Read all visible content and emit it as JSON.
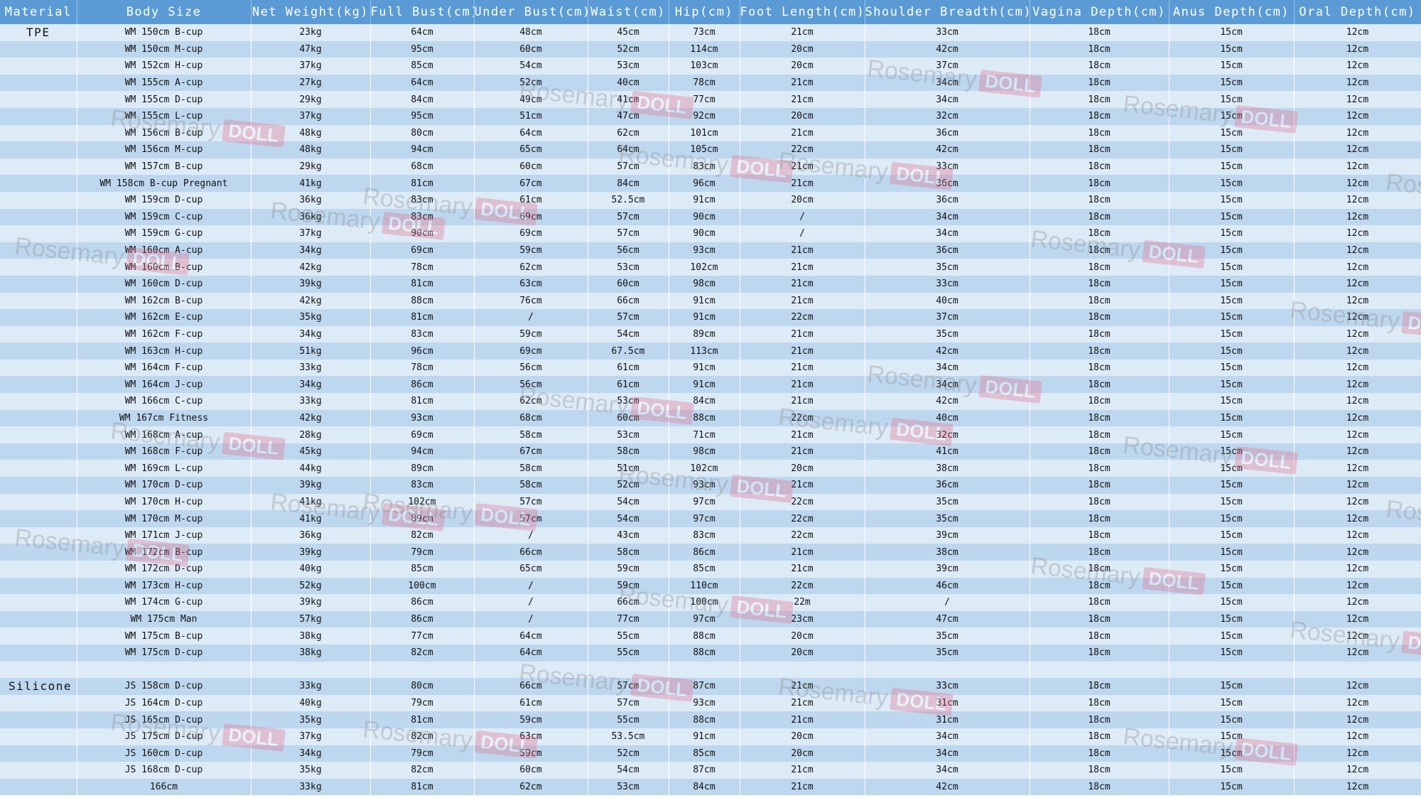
{
  "headers": [
    "Material",
    "Body Size",
    "Net Weight(kg)",
    "Full Bust(cm)",
    "Under Bust(cm)",
    "Waist(cm)",
    "Hip(cm)",
    "Foot Length(cm)",
    "Shoulder Breadth(cm)",
    "Vagina Depth(cm)",
    "Anus Depth(cm)",
    "Oral Depth(cm)"
  ],
  "watermark": {
    "text": "Rosemary",
    "badge": "DOLL"
  },
  "colors": {
    "header_bg": "#5b9bd5",
    "row_light": "#ddebf7",
    "row_dark": "#bdd7ee",
    "watermark_badge": "#e56b88"
  },
  "rows": [
    {
      "material": "TPE",
      "size": "WM 150cm B-cup",
      "weight": "23kg",
      "full_bust": "64cm",
      "under_bust": "48cm",
      "waist": "45cm",
      "hip": "73cm",
      "foot": "21cm",
      "shoulder": "33cm",
      "vagina": "18cm",
      "anus": "15cm",
      "oral": "12cm"
    },
    {
      "material": "",
      "size": "WM 150cm M-cup",
      "weight": "47kg",
      "full_bust": "95cm",
      "under_bust": "60cm",
      "waist": "52cm",
      "hip": "114cm",
      "foot": "20cm",
      "shoulder": "42cm",
      "vagina": "18cm",
      "anus": "15cm",
      "oral": "12cm"
    },
    {
      "material": "",
      "size": "WM 152cm H-cup",
      "weight": "37kg",
      "full_bust": "85cm",
      "under_bust": "54cm",
      "waist": "53cm",
      "hip": "103cm",
      "foot": "20cm",
      "shoulder": "37cm",
      "vagina": "18cm",
      "anus": "15cm",
      "oral": "12cm"
    },
    {
      "material": "",
      "size": "WM 155cm A-cup",
      "weight": "27kg",
      "full_bust": "64cm",
      "under_bust": "52cm",
      "waist": "40cm",
      "hip": "78cm",
      "foot": "21cm",
      "shoulder": "34cm",
      "vagina": "18cm",
      "anus": "15cm",
      "oral": "12cm"
    },
    {
      "material": "",
      "size": "WM 155cm D-cup",
      "weight": "29kg",
      "full_bust": "84cm",
      "under_bust": "49cm",
      "waist": "41cm",
      "hip": "77cm",
      "foot": "21cm",
      "shoulder": "34cm",
      "vagina": "18cm",
      "anus": "15cm",
      "oral": "12cm"
    },
    {
      "material": "",
      "size": "WM 155cm L-cup",
      "weight": "37kg",
      "full_bust": "95cm",
      "under_bust": "51cm",
      "waist": "47cm",
      "hip": "92cm",
      "foot": "20cm",
      "shoulder": "32cm",
      "vagina": "18cm",
      "anus": "15cm",
      "oral": "12cm"
    },
    {
      "material": "",
      "size": "WM 156cm B-cup",
      "weight": "48kg",
      "full_bust": "80cm",
      "under_bust": "64cm",
      "waist": "62cm",
      "hip": "101cm",
      "foot": "21cm",
      "shoulder": "36cm",
      "vagina": "18cm",
      "anus": "15cm",
      "oral": "12cm"
    },
    {
      "material": "",
      "size": "WM 156cm M-cup",
      "weight": "48kg",
      "full_bust": "94cm",
      "under_bust": "65cm",
      "waist": "64cm",
      "hip": "105cm",
      "foot": "22cm",
      "shoulder": "42cm",
      "vagina": "18cm",
      "anus": "15cm",
      "oral": "12cm"
    },
    {
      "material": "",
      "size": "WM 157cm B-cup",
      "weight": "29kg",
      "full_bust": "68cm",
      "under_bust": "60cm",
      "waist": "57cm",
      "hip": "83cm",
      "foot": "21cm",
      "shoulder": "33cm",
      "vagina": "18cm",
      "anus": "15cm",
      "oral": "12cm"
    },
    {
      "material": "",
      "size": "WM 158cm B-cup Pregnant",
      "weight": "41kg",
      "full_bust": "81cm",
      "under_bust": "67cm",
      "waist": "84cm",
      "hip": "96cm",
      "foot": "21cm",
      "shoulder": "36cm",
      "vagina": "18cm",
      "anus": "15cm",
      "oral": "12cm"
    },
    {
      "material": "",
      "size": "WM 159cm D-cup",
      "weight": "36kg",
      "full_bust": "83cm",
      "under_bust": "61cm",
      "waist": "52.5cm",
      "hip": "91cm",
      "foot": "20cm",
      "shoulder": "36cm",
      "vagina": "18cm",
      "anus": "15cm",
      "oral": "12cm"
    },
    {
      "material": "",
      "size": "WM 159cm C-cup",
      "weight": "36kg",
      "full_bust": "83cm",
      "under_bust": "69cm",
      "waist": "57cm",
      "hip": "90cm",
      "foot": "/",
      "shoulder": "34cm",
      "vagina": "18cm",
      "anus": "15cm",
      "oral": "12cm"
    },
    {
      "material": "",
      "size": "WM 159cm G-cup",
      "weight": "37kg",
      "full_bust": "90cm",
      "under_bust": "69cm",
      "waist": "57cm",
      "hip": "90cm",
      "foot": "/",
      "shoulder": "34cm",
      "vagina": "18cm",
      "anus": "15cm",
      "oral": "12cm"
    },
    {
      "material": "",
      "size": "WM 160cm A-cup",
      "weight": "34kg",
      "full_bust": "69cm",
      "under_bust": "59cm",
      "waist": "56cm",
      "hip": "93cm",
      "foot": "21cm",
      "shoulder": "36cm",
      "vagina": "18cm",
      "anus": "15cm",
      "oral": "12cm"
    },
    {
      "material": "",
      "size": "WM 160cm B-cup",
      "weight": "42kg",
      "full_bust": "78cm",
      "under_bust": "62cm",
      "waist": "53cm",
      "hip": "102cm",
      "foot": "21cm",
      "shoulder": "35cm",
      "vagina": "18cm",
      "anus": "15cm",
      "oral": "12cm"
    },
    {
      "material": "",
      "size": "WM 160cm D-cup",
      "weight": "39kg",
      "full_bust": "81cm",
      "under_bust": "63cm",
      "waist": "60cm",
      "hip": "98cm",
      "foot": "21cm",
      "shoulder": "33cm",
      "vagina": "18cm",
      "anus": "15cm",
      "oral": "12cm"
    },
    {
      "material": "",
      "size": "WM 162cm B-cup",
      "weight": "42kg",
      "full_bust": "88cm",
      "under_bust": "76cm",
      "waist": "66cm",
      "hip": "91cm",
      "foot": "21cm",
      "shoulder": "40cm",
      "vagina": "18cm",
      "anus": "15cm",
      "oral": "12cm"
    },
    {
      "material": "",
      "size": "WM 162cm E-cup",
      "weight": "35kg",
      "full_bust": "81cm",
      "under_bust": "/",
      "waist": "57cm",
      "hip": "91cm",
      "foot": "22cm",
      "shoulder": "37cm",
      "vagina": "18cm",
      "anus": "15cm",
      "oral": "12cm"
    },
    {
      "material": "",
      "size": "WM 162cm F-cup",
      "weight": "34kg",
      "full_bust": "83cm",
      "under_bust": "59cm",
      "waist": "54cm",
      "hip": "89cm",
      "foot": "21cm",
      "shoulder": "35cm",
      "vagina": "18cm",
      "anus": "15cm",
      "oral": "12cm"
    },
    {
      "material": "",
      "size": "WM 163cm H-cup",
      "weight": "51kg",
      "full_bust": "96cm",
      "under_bust": "69cm",
      "waist": "67.5cm",
      "hip": "113cm",
      "foot": "21cm",
      "shoulder": "42cm",
      "vagina": "18cm",
      "anus": "15cm",
      "oral": "12cm"
    },
    {
      "material": "",
      "size": "WM 164cm F-cup",
      "weight": "33kg",
      "full_bust": "78cm",
      "under_bust": "56cm",
      "waist": "61cm",
      "hip": "91cm",
      "foot": "21cm",
      "shoulder": "34cm",
      "vagina": "18cm",
      "anus": "15cm",
      "oral": "12cm"
    },
    {
      "material": "",
      "size": "WM 164cm J-cup",
      "weight": "34kg",
      "full_bust": "86cm",
      "under_bust": "56cm",
      "waist": "61cm",
      "hip": "91cm",
      "foot": "21cm",
      "shoulder": "34cm",
      "vagina": "18cm",
      "anus": "15cm",
      "oral": "12cm"
    },
    {
      "material": "",
      "size": "WM 166cm C-cup",
      "weight": "33kg",
      "full_bust": "81cm",
      "under_bust": "62cm",
      "waist": "53cm",
      "hip": "84cm",
      "foot": "21cm",
      "shoulder": "42cm",
      "vagina": "18cm",
      "anus": "15cm",
      "oral": "12cm"
    },
    {
      "material": "",
      "size": "WM 167cm Fitness",
      "weight": "42kg",
      "full_bust": "93cm",
      "under_bust": "68cm",
      "waist": "60cm",
      "hip": "88cm",
      "foot": "22cm",
      "shoulder": "40cm",
      "vagina": "18cm",
      "anus": "15cm",
      "oral": "12cm"
    },
    {
      "material": "",
      "size": "WM 168cm A-cup",
      "weight": "28kg",
      "full_bust": "69cm",
      "under_bust": "58cm",
      "waist": "53cm",
      "hip": "71cm",
      "foot": "21cm",
      "shoulder": "32cm",
      "vagina": "18cm",
      "anus": "15cm",
      "oral": "12cm"
    },
    {
      "material": "",
      "size": "WM 168cm F-cup",
      "weight": "45kg",
      "full_bust": "94cm",
      "under_bust": "67cm",
      "waist": "58cm",
      "hip": "98cm",
      "foot": "21cm",
      "shoulder": "41cm",
      "vagina": "18cm",
      "anus": "15cm",
      "oral": "12cm"
    },
    {
      "material": "",
      "size": "WM 169cm L-cup",
      "weight": "44kg",
      "full_bust": "89cm",
      "under_bust": "58cm",
      "waist": "51cm",
      "hip": "102cm",
      "foot": "20cm",
      "shoulder": "38cm",
      "vagina": "18cm",
      "anus": "15cm",
      "oral": "12cm"
    },
    {
      "material": "",
      "size": "WM 170cm D-cup",
      "weight": "39kg",
      "full_bust": "83cm",
      "under_bust": "58cm",
      "waist": "52cm",
      "hip": "93cm",
      "foot": "21cm",
      "shoulder": "36cm",
      "vagina": "18cm",
      "anus": "15cm",
      "oral": "12cm"
    },
    {
      "material": "",
      "size": "WM 170cm H-cup",
      "weight": "41kg",
      "full_bust": "102cm",
      "under_bust": "57cm",
      "waist": "54cm",
      "hip": "97cm",
      "foot": "22cm",
      "shoulder": "35cm",
      "vagina": "18cm",
      "anus": "15cm",
      "oral": "12cm"
    },
    {
      "material": "",
      "size": "WM 170cm M-cup",
      "weight": "41kg",
      "full_bust": "89cm",
      "under_bust": "57cm",
      "waist": "54cm",
      "hip": "97cm",
      "foot": "22cm",
      "shoulder": "35cm",
      "vagina": "18cm",
      "anus": "15cm",
      "oral": "12cm"
    },
    {
      "material": "",
      "size": "WM 171cm J-cup",
      "weight": "36kg",
      "full_bust": "82cm",
      "under_bust": "/",
      "waist": "43cm",
      "hip": "83cm",
      "foot": "22cm",
      "shoulder": "39cm",
      "vagina": "18cm",
      "anus": "15cm",
      "oral": "12cm"
    },
    {
      "material": "",
      "size": "WM 172cm B-cup",
      "weight": "39kg",
      "full_bust": "79cm",
      "under_bust": "66cm",
      "waist": "58cm",
      "hip": "86cm",
      "foot": "21cm",
      "shoulder": "38cm",
      "vagina": "18cm",
      "anus": "15cm",
      "oral": "12cm"
    },
    {
      "material": "",
      "size": "WM 172cm D-cup",
      "weight": "40kg",
      "full_bust": "85cm",
      "under_bust": "65cm",
      "waist": "59cm",
      "hip": "85cm",
      "foot": "21cm",
      "shoulder": "39cm",
      "vagina": "18cm",
      "anus": "15cm",
      "oral": "12cm"
    },
    {
      "material": "",
      "size": "WM 173cm H-cup",
      "weight": "52kg",
      "full_bust": "100cm",
      "under_bust": "/",
      "waist": "59cm",
      "hip": "110cm",
      "foot": "22cm",
      "shoulder": "46cm",
      "vagina": "18cm",
      "anus": "15cm",
      "oral": "12cm"
    },
    {
      "material": "",
      "size": "WM 174cm G-cup",
      "weight": "39kg",
      "full_bust": "86cm",
      "under_bust": "/",
      "waist": "66cm",
      "hip": "100cm",
      "foot": "22m",
      "shoulder": "/",
      "vagina": "18cm",
      "anus": "15cm",
      "oral": "12cm"
    },
    {
      "material": "",
      "size": "WM 175cm Man",
      "weight": "57kg",
      "full_bust": "86cm",
      "under_bust": "/",
      "waist": "77cm",
      "hip": "97cm",
      "foot": "23cm",
      "shoulder": "47cm",
      "vagina": "18cm",
      "anus": "15cm",
      "oral": "12cm"
    },
    {
      "material": "",
      "size": "WM 175cm B-cup",
      "weight": "38kg",
      "full_bust": "77cm",
      "under_bust": "64cm",
      "waist": "55cm",
      "hip": "88cm",
      "foot": "20cm",
      "shoulder": "35cm",
      "vagina": "18cm",
      "anus": "15cm",
      "oral": "12cm"
    },
    {
      "material": "",
      "size": "WM 175cm D-cup",
      "weight": "38kg",
      "full_bust": "82cm",
      "under_bust": "64cm",
      "waist": "55cm",
      "hip": "88cm",
      "foot": "20cm",
      "shoulder": "35cm",
      "vagina": "18cm",
      "anus": "15cm",
      "oral": "12cm"
    },
    {
      "material": "",
      "size": "",
      "weight": "",
      "full_bust": "",
      "under_bust": "",
      "waist": "",
      "hip": "",
      "foot": "",
      "shoulder": "",
      "vagina": "",
      "anus": "",
      "oral": ""
    },
    {
      "material": "Silicone",
      "size": "JS 158cm D-cup",
      "weight": "33kg",
      "full_bust": "80cm",
      "under_bust": "66cm",
      "waist": "57cm",
      "hip": "87cm",
      "foot": "21cm",
      "shoulder": "33cm",
      "vagina": "18cm",
      "anus": "15cm",
      "oral": "12cm"
    },
    {
      "material": "",
      "size": "JS 164cm D-cup",
      "weight": "40kg",
      "full_bust": "79cm",
      "under_bust": "61cm",
      "waist": "57cm",
      "hip": "93cm",
      "foot": "21cm",
      "shoulder": "31cm",
      "vagina": "18cm",
      "anus": "15cm",
      "oral": "12cm"
    },
    {
      "material": "",
      "size": "JS 165cm D-cup",
      "weight": "35kg",
      "full_bust": "81cm",
      "under_bust": "59cm",
      "waist": "55cm",
      "hip": "88cm",
      "foot": "21cm",
      "shoulder": "31cm",
      "vagina": "18cm",
      "anus": "15cm",
      "oral": "12cm"
    },
    {
      "material": "",
      "size": "JS 175cm D-cup",
      "weight": "37kg",
      "full_bust": "82cm",
      "under_bust": "63cm",
      "waist": "53.5cm",
      "hip": "91cm",
      "foot": "20cm",
      "shoulder": "34cm",
      "vagina": "18cm",
      "anus": "15cm",
      "oral": "12cm"
    },
    {
      "material": "",
      "size": "JS 160cm D-cup",
      "weight": "34kg",
      "full_bust": "79cm",
      "under_bust": "59cm",
      "waist": "52cm",
      "hip": "85cm",
      "foot": "20cm",
      "shoulder": "34cm",
      "vagina": "18cm",
      "anus": "15cm",
      "oral": "12cm"
    },
    {
      "material": "",
      "size": "JS 168cm D-cup",
      "weight": "35kg",
      "full_bust": "82cm",
      "under_bust": "60cm",
      "waist": "54cm",
      "hip": "87cm",
      "foot": "21cm",
      "shoulder": "34cm",
      "vagina": "18cm",
      "anus": "15cm",
      "oral": "12cm"
    },
    {
      "material": "",
      "size": "166cm",
      "weight": "33kg",
      "full_bust": "81cm",
      "under_bust": "62cm",
      "waist": "53cm",
      "hip": "84cm",
      "foot": "21cm",
      "shoulder": "42cm",
      "vagina": "18cm",
      "anus": "15cm",
      "oral": "12cm"
    }
  ]
}
